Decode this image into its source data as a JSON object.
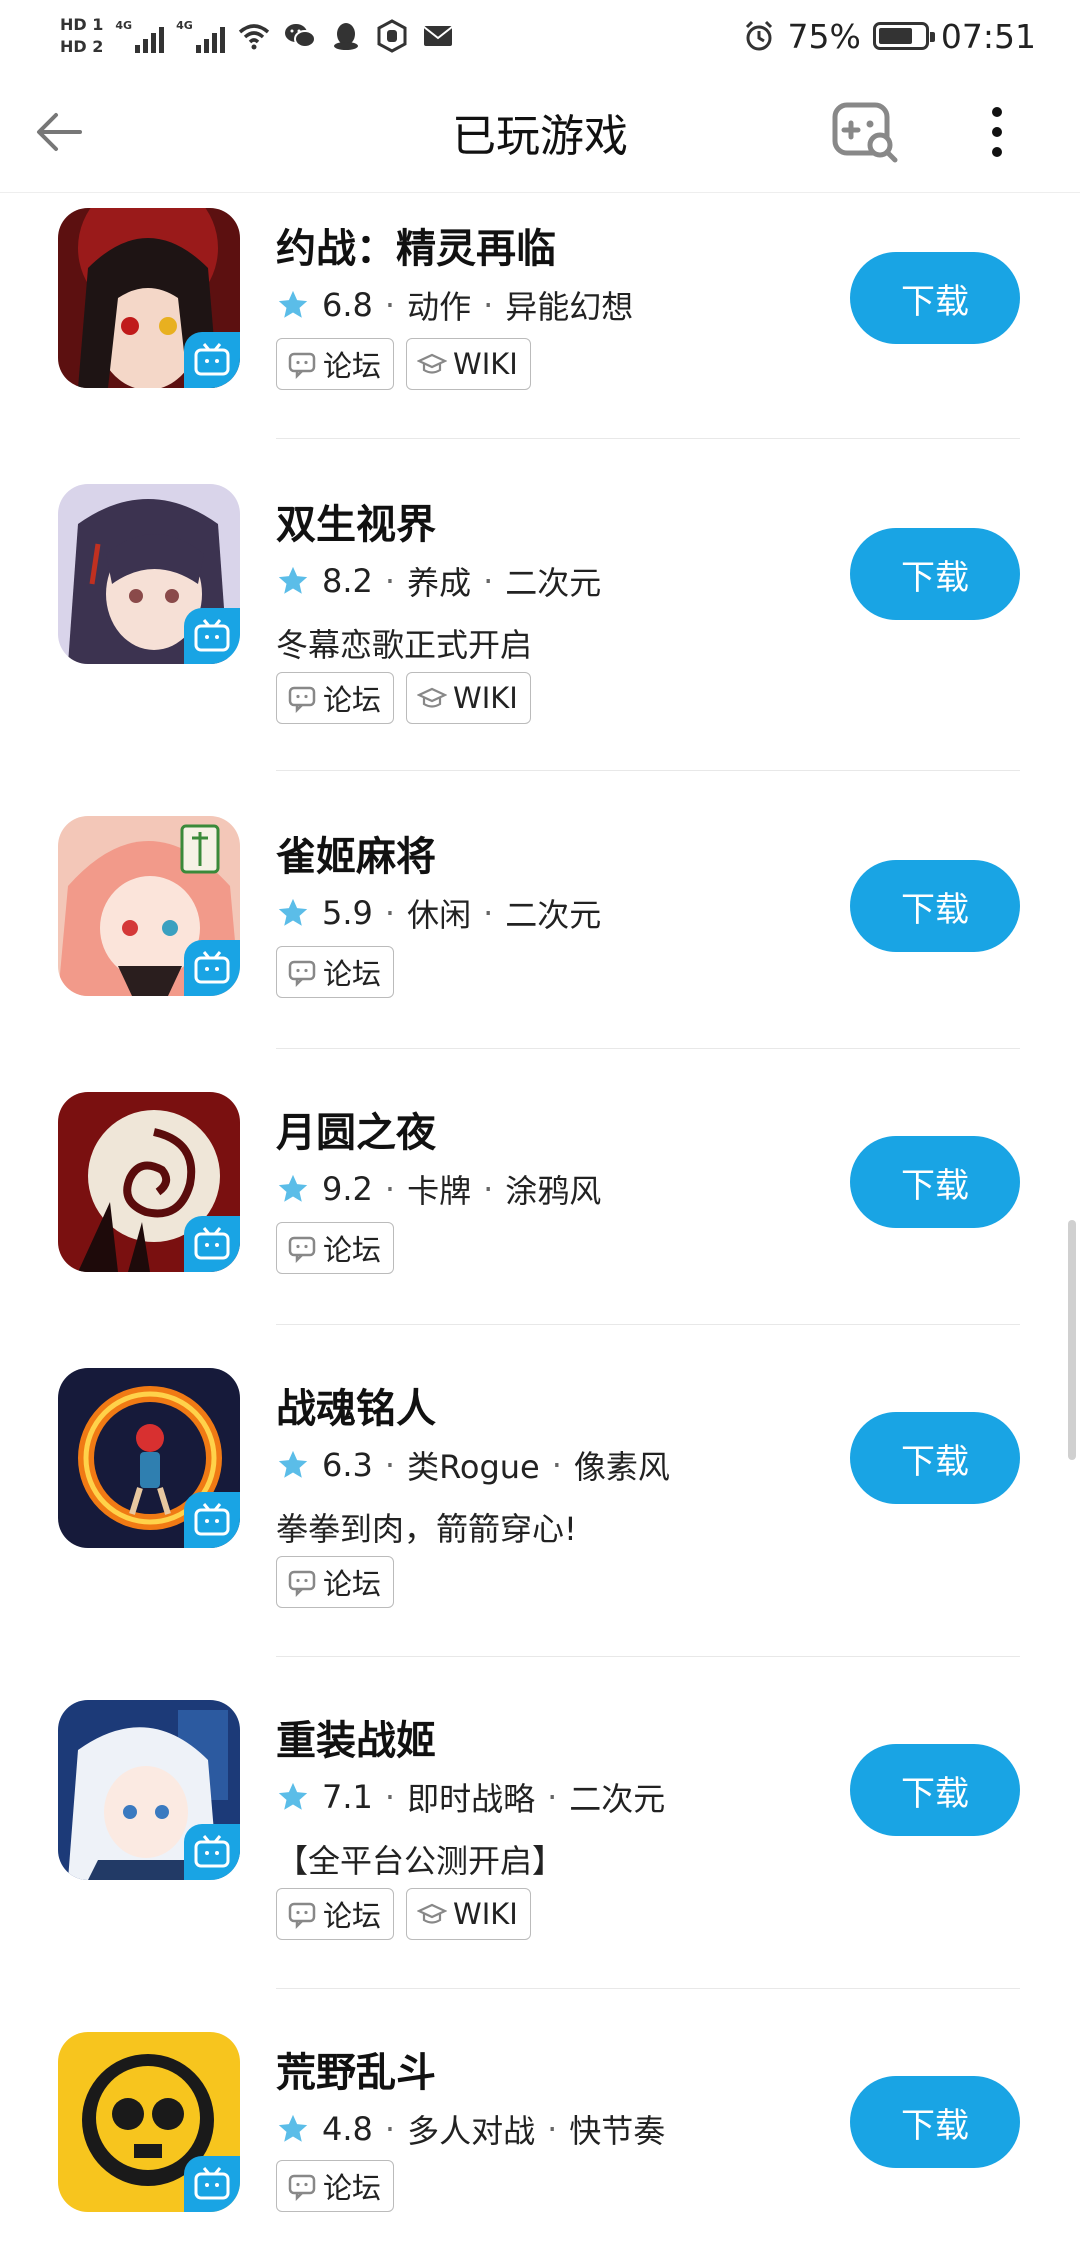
{
  "status_bar": {
    "hd1": "HD 1",
    "hd2": "HD 2",
    "net1": "4G",
    "net2": "4G",
    "battery_percent": "75%",
    "time": "07:51",
    "battery_level": 0.75
  },
  "header": {
    "title": "已玩游戏"
  },
  "games": [
    {
      "name": "约战：精灵再临",
      "rating": "6.8",
      "tag1": "动作",
      "tag2": "异能幻想",
      "desc": "",
      "forum": "论坛",
      "wiki": "WIKI",
      "button": "下载"
    },
    {
      "name": "双生视界",
      "rating": "8.2",
      "tag1": "养成",
      "tag2": "二次元",
      "desc": "冬幕恋歌正式开启",
      "forum": "论坛",
      "wiki": "WIKI",
      "button": "下载"
    },
    {
      "name": "雀姬麻将",
      "rating": "5.9",
      "tag1": "休闲",
      "tag2": "二次元",
      "desc": "",
      "forum": "论坛",
      "wiki": "",
      "button": "下载"
    },
    {
      "name": "月圆之夜",
      "rating": "9.2",
      "tag1": "卡牌",
      "tag2": "涂鸦风",
      "desc": "",
      "forum": "论坛",
      "wiki": "",
      "button": "下载"
    },
    {
      "name": "战魂铭人",
      "rating": "6.3",
      "tag1": "类Rogue",
      "tag2": "像素风",
      "desc": "拳拳到肉，箭箭穿心!",
      "forum": "论坛",
      "wiki": "",
      "button": "下载"
    },
    {
      "name": "重装战姬",
      "rating": "7.1",
      "tag1": "即时战略",
      "tag2": "二次元",
      "desc": "【全平台公测开启】",
      "forum": "论坛",
      "wiki": "WIKI",
      "button": "下载"
    },
    {
      "name": "荒野乱斗",
      "rating": "4.8",
      "tag1": "多人对战",
      "tag2": "快节奏",
      "desc": "",
      "forum": "论坛",
      "wiki": "",
      "button": "下载"
    }
  ],
  "colors": {
    "accent": "#19a4e4",
    "star": "#5bbde8"
  },
  "icons": {
    "back": "arrow-left-icon",
    "gamepad": "gamepad-search-icon",
    "more": "more-vertical-icon",
    "star": "star-icon",
    "forum": "chat-bubble-icon",
    "wiki": "graduation-cap-icon",
    "bili": "bilibili-tv-icon"
  }
}
